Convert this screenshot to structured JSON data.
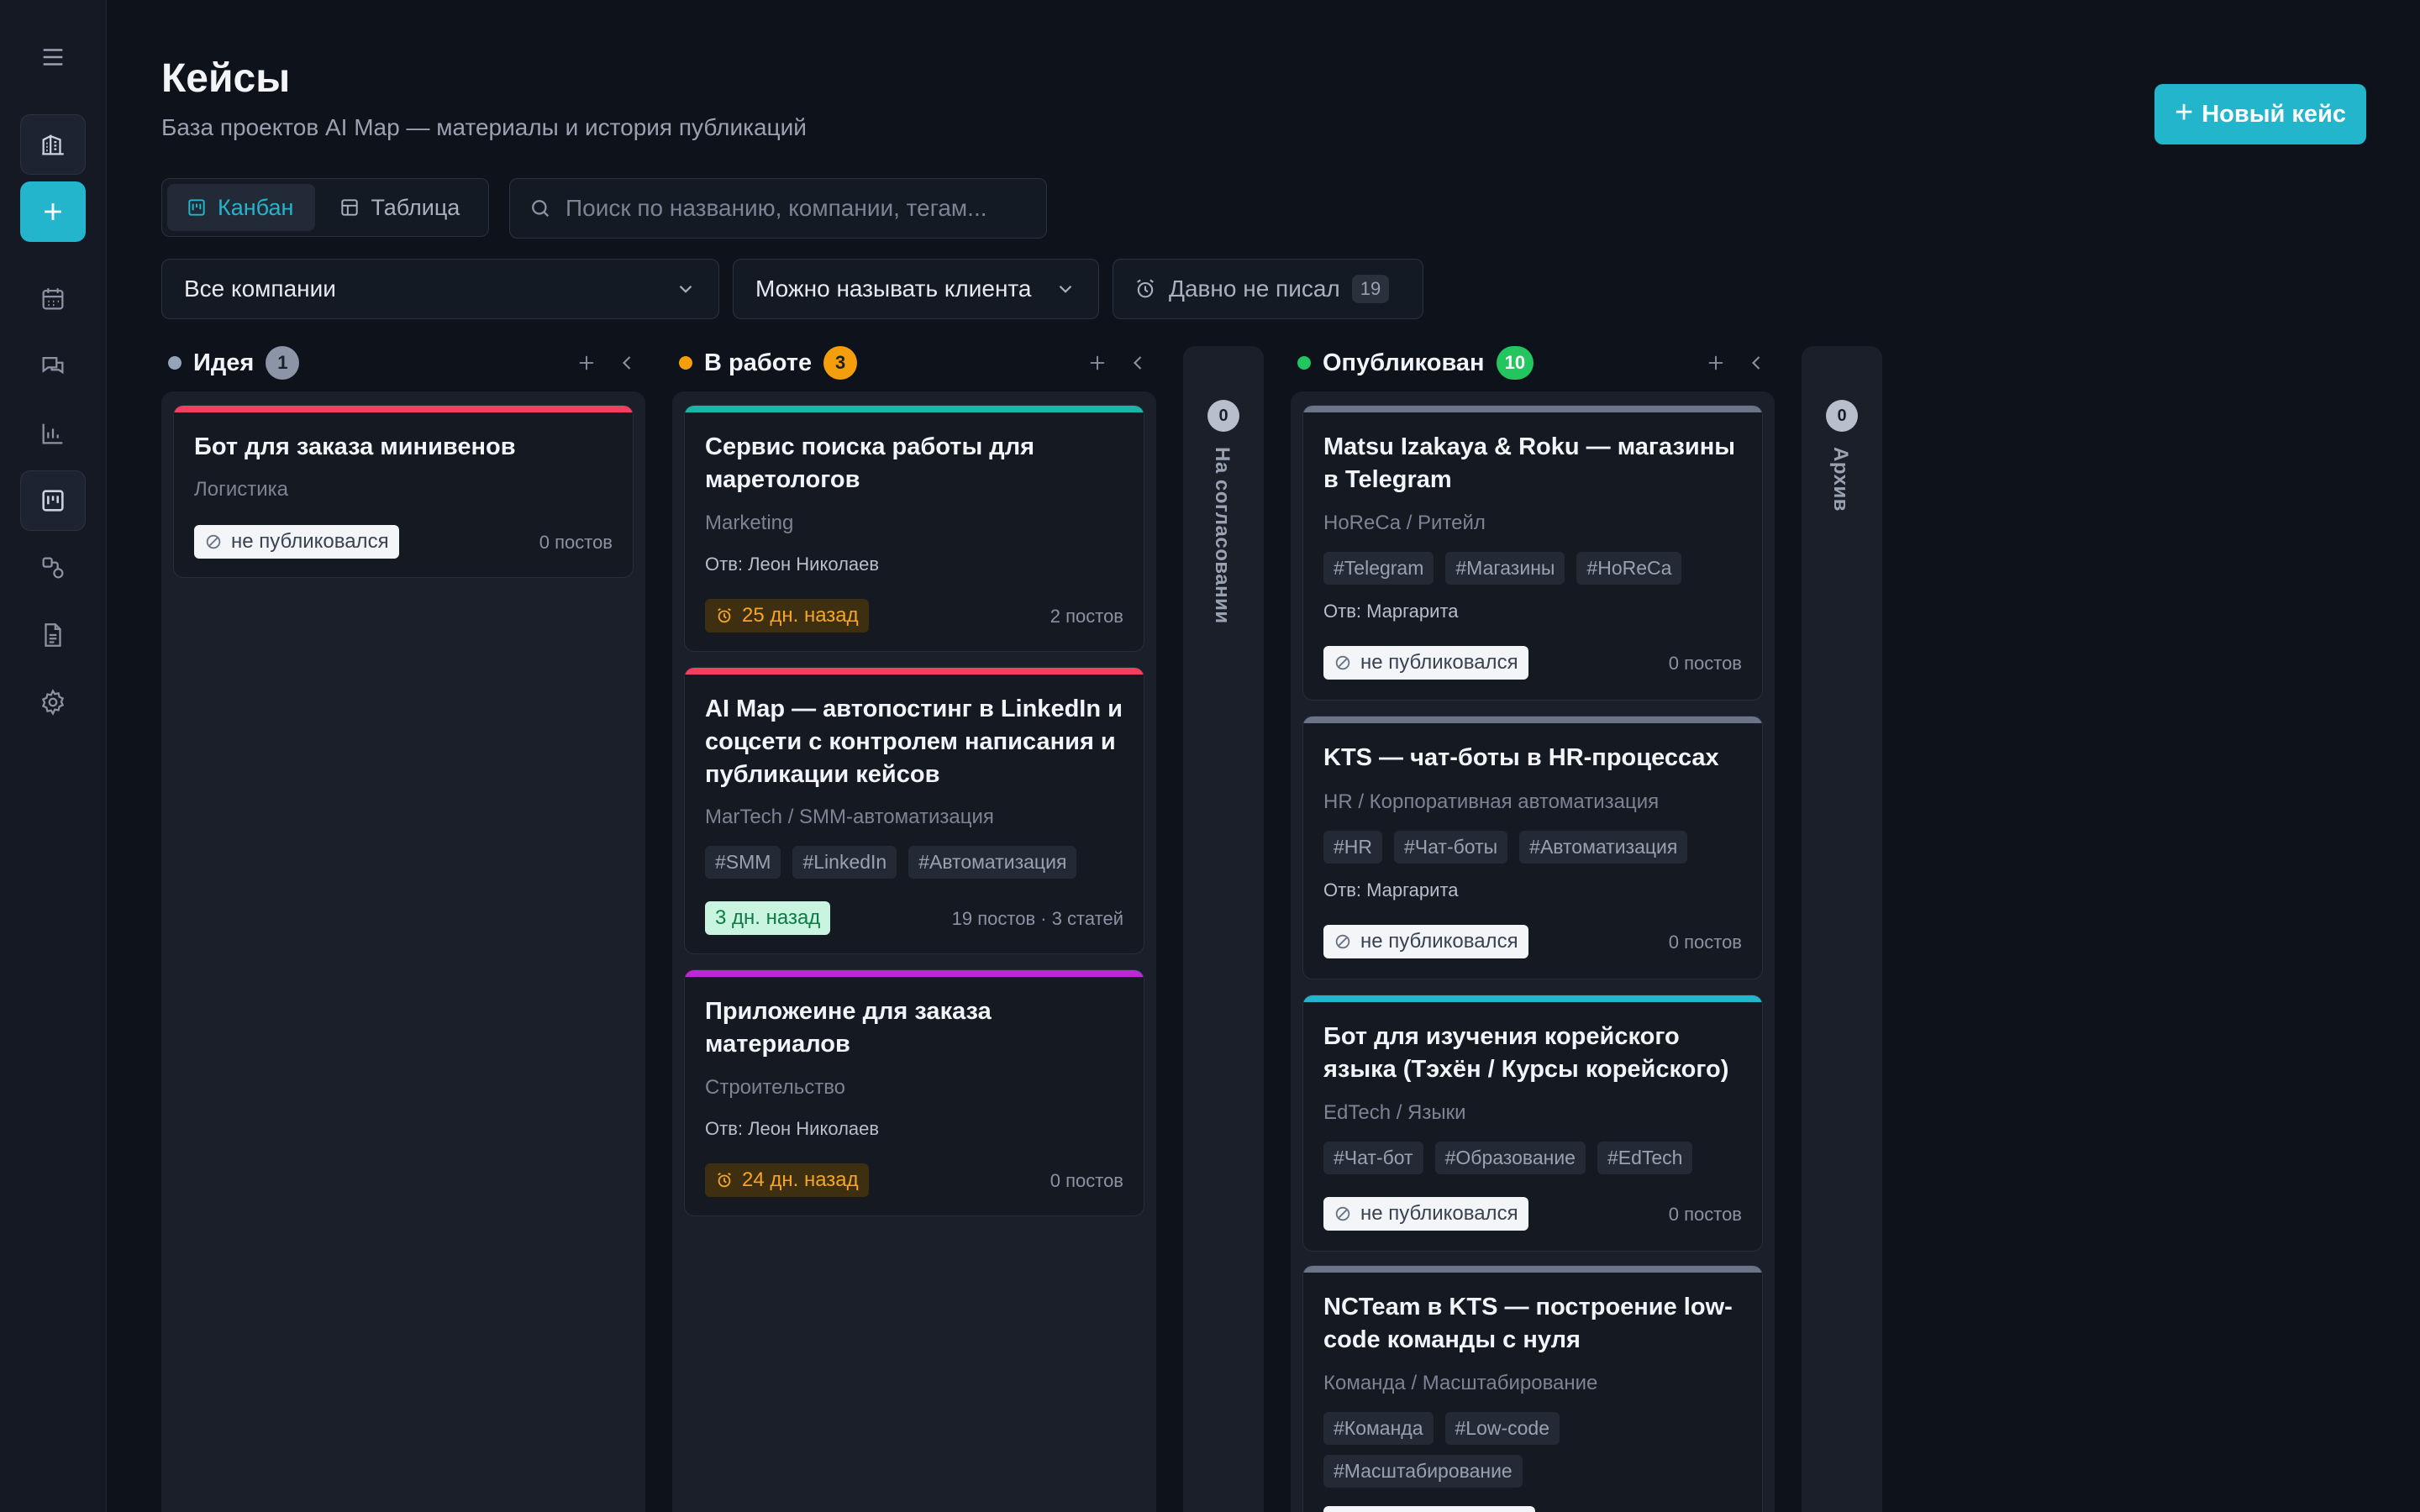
{
  "header": {
    "title": "Кейсы",
    "subtitle": "База проектов AI Map — материалы и история публикаций",
    "new_button": "Новый кейс"
  },
  "view_toggle": {
    "kanban": "Канбан",
    "table": "Таблица",
    "active": "kanban"
  },
  "search": {
    "placeholder": "Поиск по названию, компании, тегам..."
  },
  "filters": {
    "company": "Все компании",
    "client_naming": "Можно называть клиента",
    "stale_label": "Давно не писал",
    "stale_count": "19"
  },
  "colors": {
    "accent": "#22b5cc",
    "idea_dot": "#94a3b8",
    "in_work_dot": "#f59e0b",
    "published_dot": "#22c55e"
  },
  "columns": {
    "idea": {
      "title": "Идея",
      "count": "1",
      "cards": [
        {
          "title": "Бот для заказа минивенов",
          "category": "Логистика",
          "status": "не публиковался",
          "posts": "0 постов"
        }
      ]
    },
    "in_work": {
      "title": "В работе",
      "count": "3",
      "cards": [
        {
          "title": "Сервис поиска работы для маретологов",
          "category": "Marketing",
          "owner": "Отв: Леон Николаев",
          "status": "25 дн. назад",
          "posts": "2 постов"
        },
        {
          "title": "AI Map — автопостинг в LinkedIn и соцсети с контролем написания и публикации кейсов",
          "category": "MarTech / SMM-автоматизация",
          "tags": [
            "#SMM",
            "#LinkedIn",
            "#Автоматизация"
          ],
          "status": "3 дн. назад",
          "posts": "19 постов · 3 статей"
        },
        {
          "title": "Приложеине для заказа материалов",
          "category": "Строительство",
          "owner": "Отв: Леон Николаев",
          "status": "24 дн. назад",
          "posts": "0 постов"
        }
      ]
    },
    "approval": {
      "title": "На согласовании",
      "count": "0"
    },
    "published": {
      "title": "Опубликован",
      "count": "10",
      "cards": [
        {
          "title": "Matsu Izakaya & Roku — магазины в Telegram",
          "category": "HoReCa / Ритейл",
          "tags": [
            "#Telegram",
            "#Магазины",
            "#HoReCa"
          ],
          "owner": "Отв: Маргарита",
          "status": "не публиковался",
          "posts": "0 постов"
        },
        {
          "title": "KTS — чат-боты в HR-процессах",
          "category": "HR / Корпоративная автоматизация",
          "tags": [
            "#HR",
            "#Чат-боты",
            "#Автоматизация"
          ],
          "owner": "Отв: Маргарита",
          "status": "не публиковался",
          "posts": "0 постов"
        },
        {
          "title": "Бот для изучения корейского языка (Тэхён / Курсы корейского)",
          "category": "EdTech / Языки",
          "tags": [
            "#Чат-бот",
            "#Образование",
            "#EdTech"
          ],
          "status": "не публиковался",
          "posts": "0 постов"
        },
        {
          "title": "NCTeam в KTS — построение low-code команды с нуля",
          "category": "Команда / Масштабирование",
          "tags": [
            "#Команда",
            "#Low-code",
            "#Масштабирование"
          ]
        }
      ]
    },
    "archive": {
      "title": "Архив",
      "count": "0"
    }
  }
}
